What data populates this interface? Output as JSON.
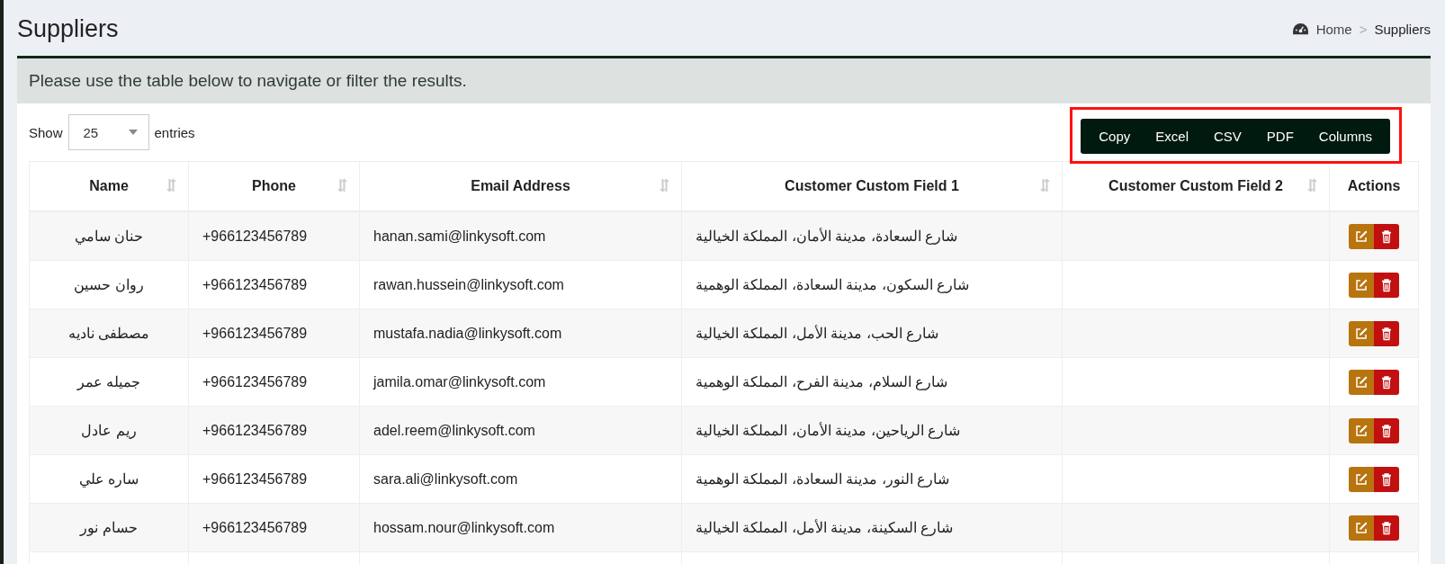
{
  "page_title": "Suppliers",
  "breadcrumb": {
    "home": "Home",
    "current": "Suppliers"
  },
  "breadcrumb_separator": ">",
  "panel_message": "Please use the table below to navigate or filter the results.",
  "length_menu": {
    "prefix": "Show",
    "value": "25",
    "suffix": "entries"
  },
  "export_buttons": {
    "copy": "Copy",
    "excel": "Excel",
    "csv": "CSV",
    "pdf": "PDF",
    "columns": "Columns"
  },
  "table": {
    "columns": {
      "name": {
        "label": "Name",
        "sortable": true
      },
      "phone": {
        "label": "Phone",
        "sortable": true
      },
      "email": {
        "label": "Email Address",
        "sortable": true
      },
      "custom_field_1": {
        "label": "Customer Custom Field 1",
        "sortable": true
      },
      "custom_field_2": {
        "label": "Customer Custom Field 2",
        "sortable": true
      },
      "actions": {
        "label": "Actions",
        "sortable": false
      }
    },
    "rows": [
      {
        "name": "حنان سامي",
        "phone": "+966123456789",
        "email": "hanan.sami@linkysoft.com",
        "custom_field_1": "شارع السعادة، مدينة الأمان، المملكة الخيالية"
      },
      {
        "name": "روان حسين",
        "phone": "+966123456789",
        "email": "rawan.hussein@linkysoft.com",
        "custom_field_1": "شارع السكون، مدينة السعادة، المملكة الوهمية"
      },
      {
        "name": "مصطفى ناديه",
        "phone": "+966123456789",
        "email": "mustafa.nadia@linkysoft.com",
        "custom_field_1": "شارع الحب، مدينة الأمل، المملكة الخيالية"
      },
      {
        "name": "جميله عمر",
        "phone": "+966123456789",
        "email": "jamila.omar@linkysoft.com",
        "custom_field_1": "شارع السلام، مدينة الفرح، المملكة الوهمية"
      },
      {
        "name": "ريم عادل",
        "phone": "+966123456789",
        "email": "adel.reem@linkysoft.com",
        "custom_field_1": "شارع الرياحين، مدينة الأمان، المملكة الخيالية"
      },
      {
        "name": "ساره علي",
        "phone": "+966123456789",
        "email": "sara.ali@linkysoft.com",
        "custom_field_1": "شارع النور، مدينة السعادة، المملكة الوهمية"
      },
      {
        "name": "حسام نور",
        "phone": "+966123456789",
        "email": "hossam.nour@linkysoft.com",
        "custom_field_1": "شارع السكينة، مدينة الأمل، المملكة الخيالية"
      }
    ]
  }
}
